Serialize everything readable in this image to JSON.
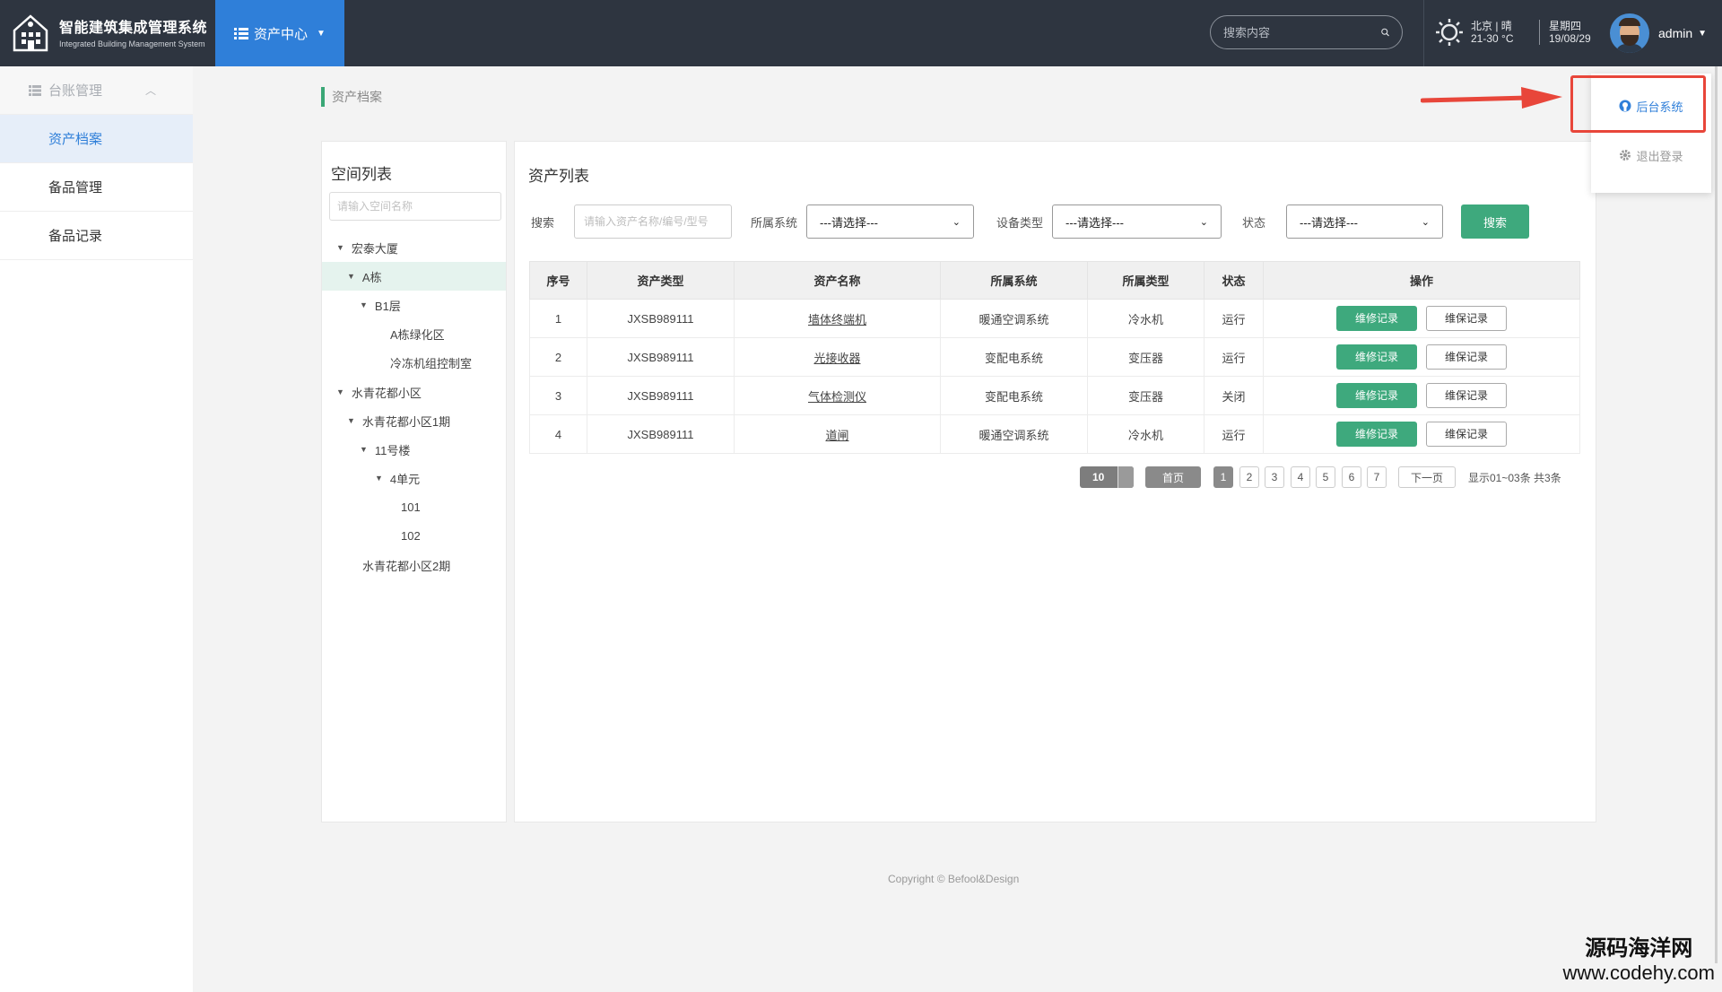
{
  "header": {
    "logo_title": "智能建筑集成管理系统",
    "logo_subtitle": "Integrated Building Management System",
    "nav_label": "资产中心",
    "search_placeholder": "搜索内容",
    "weather_city": "北京 | 晴",
    "weather_temp": "21-30 °C",
    "weekday": "星期四",
    "date": "19/08/29",
    "username": "admin"
  },
  "sidebar": {
    "group_label": "台账管理",
    "items": [
      {
        "label": "资产档案",
        "active": true
      },
      {
        "label": "备品管理",
        "active": false
      },
      {
        "label": "备品记录",
        "active": false
      }
    ]
  },
  "breadcrumb": "资产档案",
  "space_panel": {
    "title": "空间列表",
    "search_placeholder": "请输入空间名称",
    "tree": [
      {
        "label": "宏泰大厦",
        "expanded": true
      },
      {
        "label": "A栋",
        "expanded": true,
        "selected": true
      },
      {
        "label": "B1层",
        "expanded": true
      },
      {
        "label": "A栋绿化区"
      },
      {
        "label": "冷冻机组控制室"
      },
      {
        "label": "水青花都小区",
        "expanded": true
      },
      {
        "label": "水青花都小区1期",
        "expanded": true
      },
      {
        "label": "11号楼",
        "expanded": true
      },
      {
        "label": "4单元",
        "expanded": true
      },
      {
        "label": "101"
      },
      {
        "label": "102"
      },
      {
        "label": "水青花都小区2期"
      }
    ]
  },
  "asset_panel": {
    "title": "资产列表",
    "filters": {
      "search_label": "搜索",
      "search_placeholder": "请输入资产名称/编号/型号",
      "system_label": "所属系统",
      "system_value": "---请选择---",
      "device_label": "设备类型",
      "device_value": "---请选择---",
      "status_label": "状态",
      "status_value": "---请选择---",
      "search_button": "搜索"
    },
    "columns": [
      "序号",
      "资产类型",
      "资产名称",
      "所属系统",
      "所属类型",
      "状态",
      "操作"
    ],
    "rows": [
      {
        "no": "1",
        "type": "JXSB989111",
        "name": "墙体终端机",
        "system": "暖通空调系统",
        "category": "冷水机",
        "status": "运行"
      },
      {
        "no": "2",
        "type": "JXSB989111",
        "name": "光接收器",
        "system": "变配电系统",
        "category": "变压器",
        "status": "运行"
      },
      {
        "no": "3",
        "type": "JXSB989111",
        "name": "气体检测仪",
        "system": "变配电系统",
        "category": "变压器",
        "status": "关闭"
      },
      {
        "no": "4",
        "type": "JXSB989111",
        "name": "道闸",
        "system": "暖通空调系统",
        "category": "冷水机",
        "status": "运行"
      }
    ],
    "repair_label": "维修记录",
    "maint_label": "维保记录",
    "pager": {
      "page_size": "10",
      "first": "首页",
      "pages": [
        "1",
        "2",
        "3",
        "4",
        "5",
        "6",
        "7"
      ],
      "current": "1",
      "next": "下一页",
      "info": "显示01~03条 共3条"
    }
  },
  "footer": {
    "copyright": "Copyright © Befool&Design"
  },
  "user_menu": {
    "backend": "后台系统",
    "logout": "退出登录"
  },
  "watermark": {
    "cn": "源码海洋网",
    "url": "www.codehy.com"
  },
  "colors": {
    "header_bg": "#2e3540",
    "accent_blue": "#2f7fd9",
    "accent_green": "#3ea97d",
    "highlight_red": "#e8463a"
  }
}
